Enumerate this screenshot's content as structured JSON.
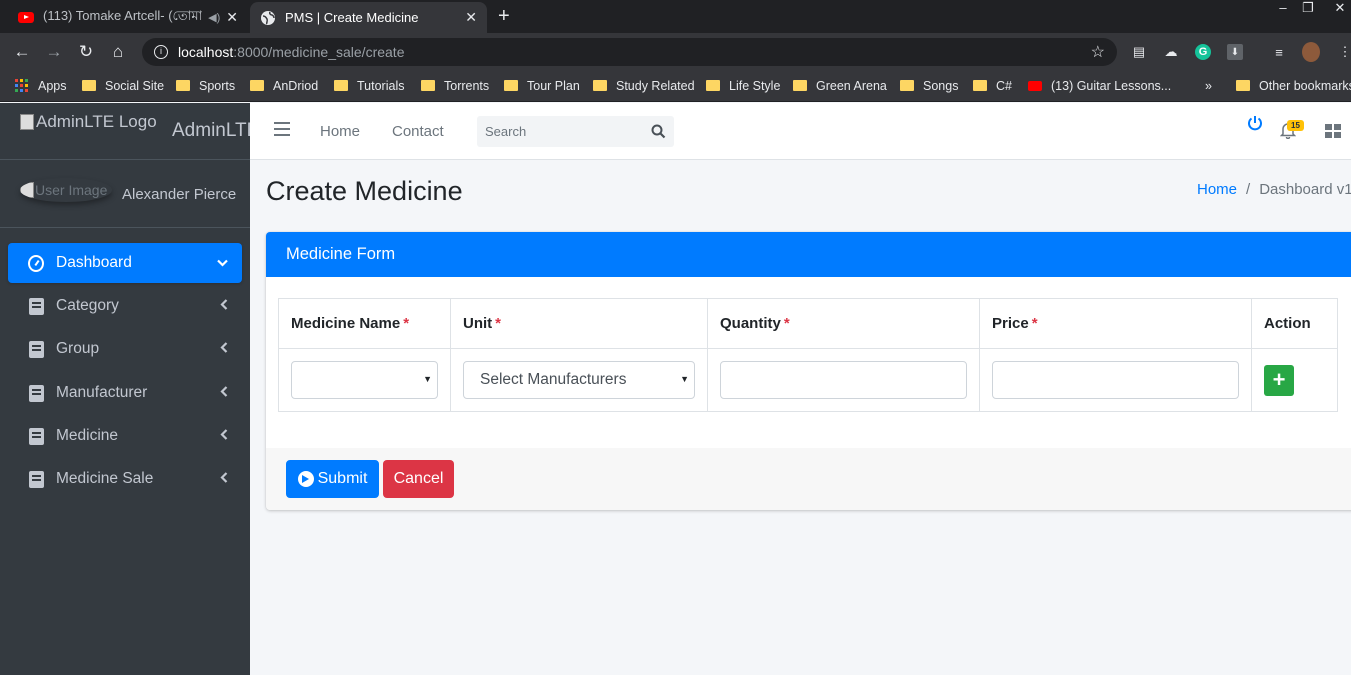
{
  "browser": {
    "tabs": [
      {
        "title": "(113) Tomake Artcell- (তোমা",
        "icon": "youtube-icon",
        "active": false
      },
      {
        "title": "PMS | Create Medicine",
        "icon": "globe-icon",
        "active": true
      }
    ],
    "new_tab_label": "+",
    "url": {
      "host": "localhost",
      "path": ":8000/medicine_sale/create"
    },
    "bookmarks": [
      {
        "label": "Apps",
        "icon": "apps-grid-icon"
      },
      {
        "label": "Social Site",
        "icon": "folder-icon"
      },
      {
        "label": "Sports",
        "icon": "folder-icon"
      },
      {
        "label": "AnDriod",
        "icon": "folder-icon"
      },
      {
        "label": "Tutorials",
        "icon": "folder-icon"
      },
      {
        "label": "Torrents",
        "icon": "folder-icon"
      },
      {
        "label": "Tour Plan",
        "icon": "folder-icon"
      },
      {
        "label": "Study Related",
        "icon": "folder-icon"
      },
      {
        "label": "Life Style",
        "icon": "folder-icon"
      },
      {
        "label": "Green Arena",
        "icon": "folder-icon"
      },
      {
        "label": "Songs",
        "icon": "folder-icon"
      },
      {
        "label": "C#",
        "icon": "folder-icon"
      },
      {
        "label": "(13) Guitar Lessons...",
        "icon": "youtube-icon"
      }
    ],
    "bookmarks_overflow": "»",
    "other_bookmarks": "Other bookmarks"
  },
  "sidebar": {
    "brand_logo_alt": "AdminLTE Logo",
    "brand_text": "AdminLTE",
    "user_image_alt": "User Image",
    "user_name": "Alexander Pierce",
    "items": [
      {
        "label": "Dashboard",
        "icon": "dashboard-gauge-icon",
        "active": true,
        "chevron": "down"
      },
      {
        "label": "Category",
        "icon": "book-icon",
        "active": false,
        "chevron": "left"
      },
      {
        "label": "Group",
        "icon": "book-icon",
        "active": false,
        "chevron": "left"
      },
      {
        "label": "Manufacturer",
        "icon": "book-icon",
        "active": false,
        "chevron": "left"
      },
      {
        "label": "Medicine",
        "icon": "book-icon",
        "active": false,
        "chevron": "left"
      },
      {
        "label": "Medicine Sale",
        "icon": "book-icon",
        "active": false,
        "chevron": "left"
      }
    ]
  },
  "topnav": {
    "links": [
      "Home",
      "Contact"
    ],
    "search_placeholder": "Search",
    "notification_count": "15"
  },
  "page": {
    "title": "Create Medicine",
    "breadcrumb": [
      "Home",
      "Dashboard v1"
    ]
  },
  "form": {
    "card_title": "Medicine Form",
    "columns": [
      {
        "label": "Medicine Name",
        "required": true
      },
      {
        "label": "Unit",
        "required": true
      },
      {
        "label": "Quantity",
        "required": true
      },
      {
        "label": "Price",
        "required": true
      },
      {
        "label": "Action",
        "required": false
      }
    ],
    "required_mark": "*",
    "medicine_name_value": "",
    "unit_value": "Select Manufacturers",
    "quantity_value": "",
    "price_value": "",
    "add_button_label": "+",
    "submit_label": "Submit",
    "cancel_label": "Cancel"
  },
  "colors": {
    "primary": "#007bff",
    "danger": "#dc3545",
    "success": "#28a745",
    "sidebar": "#343a40",
    "badge": "#ffc107"
  }
}
